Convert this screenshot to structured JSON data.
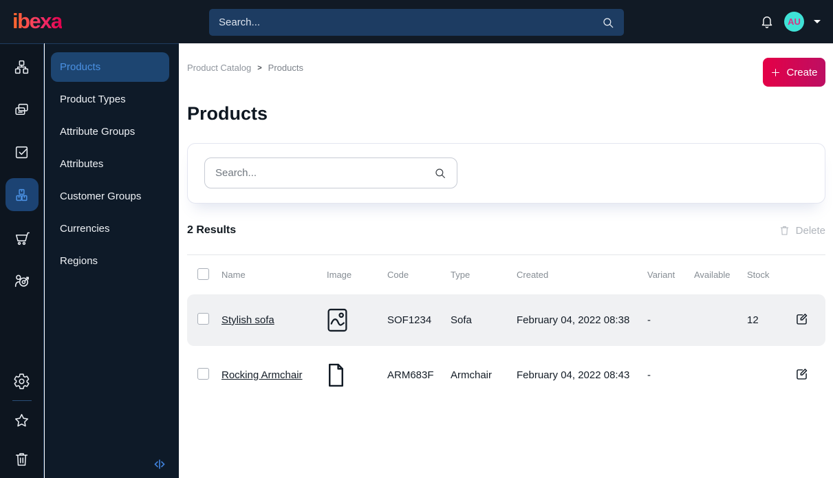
{
  "topbar": {
    "logo_text": "ibexa",
    "search_placeholder": "Search...",
    "avatar_initials": "AU"
  },
  "icon_rail": {
    "items": [
      "content-tree-icon",
      "pages-icon",
      "tasks-icon",
      "product-catalog-icon",
      "commerce-cart-icon",
      "audience-target-icon",
      "settings-gear-icon",
      "bookmarks-star-icon",
      "trash-icon"
    ],
    "active_item": "product-catalog-icon"
  },
  "sidebar": {
    "items": [
      {
        "label": "Products",
        "active": true
      },
      {
        "label": "Product Types",
        "active": false
      },
      {
        "label": "Attribute Groups",
        "active": false
      },
      {
        "label": "Attributes",
        "active": false
      },
      {
        "label": "Customer Groups",
        "active": false
      },
      {
        "label": "Currencies",
        "active": false
      },
      {
        "label": "Regions",
        "active": false
      }
    ]
  },
  "main": {
    "breadcrumb": [
      "Product Catalog",
      "Products"
    ],
    "create_label": "Create",
    "title": "Products",
    "filter_search_placeholder": "Search...",
    "results_label": "2 Results",
    "delete_label": "Delete",
    "table": {
      "columns": [
        "Name",
        "Image",
        "Code",
        "Type",
        "Created",
        "Variant",
        "Available",
        "Stock"
      ],
      "rows": [
        {
          "name": "Stylish sofa",
          "image_icon": "image-thumbnail-icon",
          "code": "SOF1234",
          "type": "Sofa",
          "created": "February 04, 2022 08:38",
          "variant": "-",
          "available": true,
          "stock": "12"
        },
        {
          "name": "Rocking Armchair",
          "image_icon": "document-icon",
          "code": "ARM683F",
          "type": "Armchair",
          "created": "February 04, 2022 08:43",
          "variant": "-",
          "available": false,
          "stock": ""
        }
      ]
    }
  },
  "colors": {
    "topbar_bg": "#111a25",
    "rail_bg": "#0d151f",
    "sidebar_bg": "#0e1a28",
    "active_pill_bg": "#1d4571",
    "active_text": "#4a90e2",
    "accent_gradient_start": "#e50046",
    "accent_gradient_end": "#bc0f63",
    "logo_gradient": [
      "#ff6a2b",
      "#f5356a",
      "#e1004d"
    ],
    "available_green": "#18a62c",
    "unavailable_gray": "#b3b7bc",
    "avatar_bg": "#3fe1d6",
    "avatar_text": "#d63384",
    "row_shaded_bg": "#f0f1f3"
  }
}
